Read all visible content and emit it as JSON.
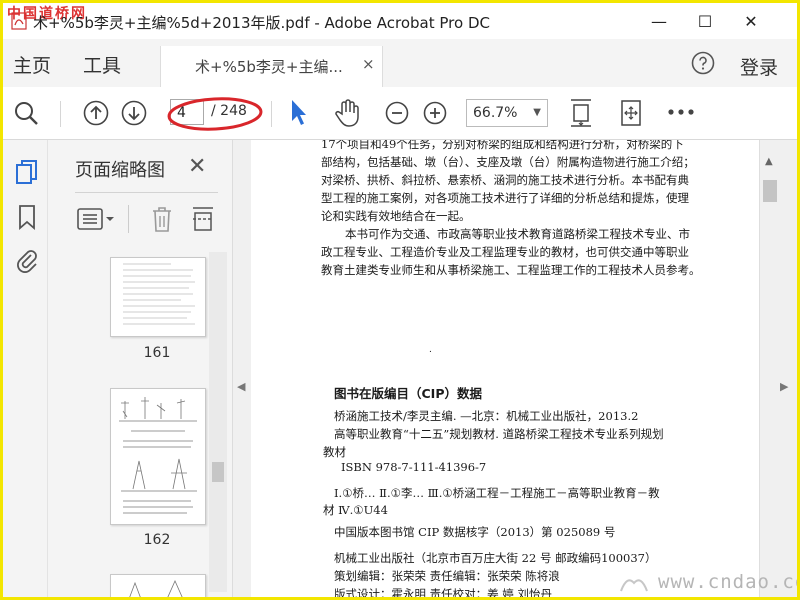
{
  "window": {
    "title": "术+%5b李灵+主编%5d+2013年版.pdf - Adobe Acrobat Pro DC",
    "minimize_glyph": "—",
    "maximize_glyph": "☐",
    "close_glyph": "✕"
  },
  "watermarks": {
    "top_left": "中国道桥网",
    "bottom_right": "www.cndao.com"
  },
  "menu": {
    "home": "主页",
    "tools": "工具",
    "doc_tab": "术+%5b李灵+主编...",
    "doc_tab_close": "×",
    "login": "登录"
  },
  "toolbar": {
    "current_page": "4",
    "total_pages": "/ 248",
    "zoom": "66.7%",
    "highlight_color": "#d9262b",
    "accent_color": "#2b6fd6"
  },
  "panel": {
    "title": "页面缩略图",
    "close": "✕",
    "thumbnails": [
      {
        "page_label": "161"
      },
      {
        "page_label": "162"
      }
    ]
  },
  "document": {
    "body_lines": [
      "17个项目和49个任务，分别对桥梁的组成和结构进行分析，对桥梁的下",
      "部结构，包括基础、墩（台）、支座及墩（台）附属构造物进行施工介绍；",
      "对梁桥、拱桥、斜拉桥、悬索桥、涵洞的施工技术进行分析。本书配有典",
      "型工程的施工案例，对各项施工技术进行了详细的分析总结和提炼，使理",
      "论和实践有效地结合在一起。"
    ],
    "body_lines_2": [
      "本书可作为交通、市政高等职业技术教育道路桥梁工程技术专业、市",
      "政工程专业、工程造价专业及工程监理专业的教材，也可供交通中等职业",
      "教育土建类专业师生和从事桥梁施工、工程监理工作的工程技术人员参考。"
    ],
    "dot": ".",
    "cip_title": "图书在版编目（CIP）数据",
    "cip_lines": [
      "桥涵施工技术/李灵主编. —北京：机械工业出版社，2013.2",
      "高等职业教育“十二五”规划教材. 道路桥梁工程技术专业系列规划",
      "教材",
      "ISBN 978-7-111-41396-7",
      "Ⅰ.①桥… Ⅱ.①李… Ⅲ.①桥涵工程－工程施工－高等职业教育－教",
      "材 Ⅳ.①U44",
      "中国版本图书馆 CIP 数据核字（2013）第 025089 号",
      "机械工业出版社（北京市百万庄大街 22 号  邮政编码100037）",
      "策划编辑：张荣荣  责任编辑：张荣荣  陈将浪",
      "版式设计：霍永明  责任校对：姜  婷  刘怡丹"
    ]
  }
}
